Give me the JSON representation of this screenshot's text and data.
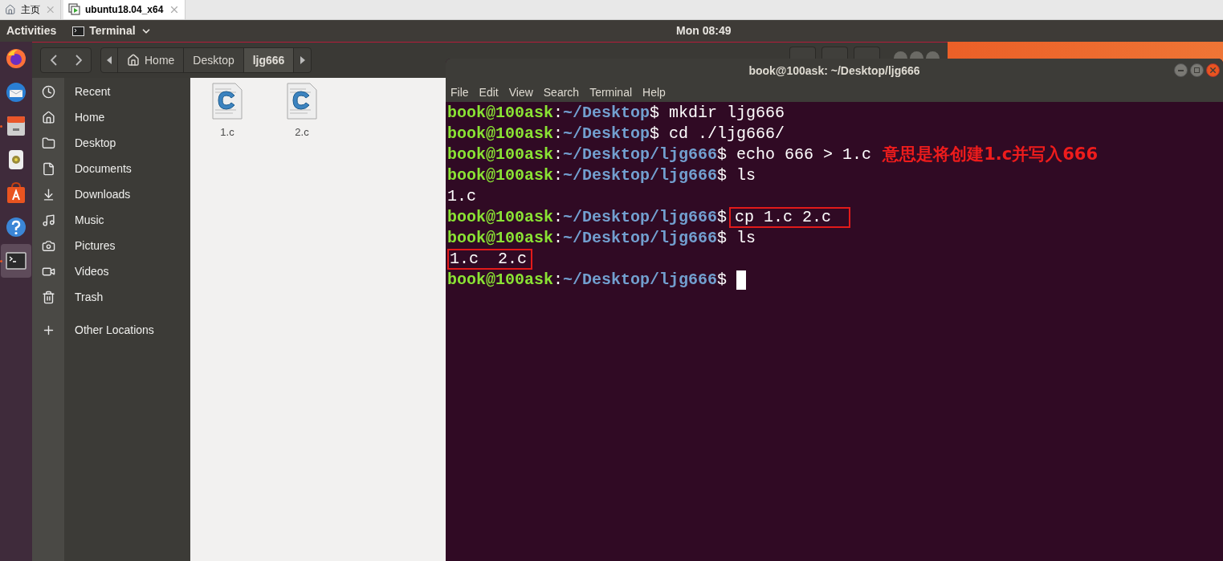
{
  "browser_tabs": [
    {
      "kind": "home",
      "label": "主页",
      "selected": false
    },
    {
      "kind": "vm",
      "label": "ubuntu18.04_x64",
      "selected": true
    }
  ],
  "top_bar": {
    "activities": "Activities",
    "app_menu": "Terminal",
    "clock": "Mon 08:49"
  },
  "dock": [
    {
      "kind": "browser",
      "running": false,
      "selected": false
    },
    {
      "kind": "mail",
      "running": false,
      "selected": false
    },
    {
      "kind": "files",
      "running": true,
      "selected": false
    },
    {
      "kind": "speaker",
      "running": false,
      "selected": false
    },
    {
      "kind": "store",
      "running": false,
      "selected": false
    },
    {
      "kind": "help",
      "running": false,
      "selected": false
    },
    {
      "kind": "terminal",
      "running": true,
      "selected": true
    }
  ],
  "files_window": {
    "breadcrumbs": [
      {
        "label": "Home",
        "kind": "home",
        "selected": false
      },
      {
        "label": "Desktop",
        "kind": "folder",
        "selected": false
      },
      {
        "label": "ljg666",
        "kind": "folder",
        "selected": true
      }
    ],
    "sidebar": [
      {
        "kind": "recent",
        "label": "Recent"
      },
      {
        "kind": "home",
        "label": "Home"
      },
      {
        "kind": "desktop",
        "label": "Desktop"
      },
      {
        "kind": "documents",
        "label": "Documents"
      },
      {
        "kind": "downloads",
        "label": "Downloads"
      },
      {
        "kind": "music",
        "label": "Music"
      },
      {
        "kind": "pictures",
        "label": "Pictures"
      },
      {
        "kind": "videos",
        "label": "Videos"
      },
      {
        "kind": "trash",
        "label": "Trash"
      },
      {
        "kind": "other",
        "label": "Other Locations"
      }
    ],
    "files": [
      {
        "name": "1.c"
      },
      {
        "name": "2.c"
      }
    ]
  },
  "terminal": {
    "title": "book@100ask: ~/Desktop/ljg666",
    "menu": [
      "File",
      "Edit",
      "View",
      "Search",
      "Terminal",
      "Help"
    ],
    "lines": [
      {
        "kind": "prompt",
        "user": "book@100ask",
        "colon": ":",
        "path": "~/Desktop",
        "symbol": "$",
        "command": "mkdir ljg666"
      },
      {
        "kind": "prompt",
        "user": "book@100ask",
        "colon": ":",
        "path": "~/Desktop",
        "symbol": "$",
        "command": "cd ./ljg666/"
      },
      {
        "kind": "prompt",
        "user": "book@100ask",
        "colon": ":",
        "path": "~/Desktop/ljg666",
        "symbol": "$",
        "command": "echo 666 > 1.c",
        "annotation": "意思是将创建1.c并写入666"
      },
      {
        "kind": "prompt",
        "user": "book@100ask",
        "colon": ":",
        "path": "~/Desktop/ljg666",
        "symbol": "$",
        "command": "ls"
      },
      {
        "kind": "output",
        "text": "1.c"
      },
      {
        "kind": "prompt",
        "user": "book@100ask",
        "colon": ":",
        "path": "~/Desktop/ljg666",
        "symbol": "$",
        "command": "cp 1.c 2.c",
        "boxed": true
      },
      {
        "kind": "prompt",
        "user": "book@100ask",
        "colon": ":",
        "path": "~/Desktop/ljg666",
        "symbol": "$",
        "command": "ls"
      },
      {
        "kind": "output",
        "text": "1.c  2.c",
        "boxed": true
      },
      {
        "kind": "prompt",
        "user": "book@100ask",
        "colon": ":",
        "path": "~/Desktop/ljg666",
        "symbol": "$",
        "cursor": true
      }
    ]
  }
}
